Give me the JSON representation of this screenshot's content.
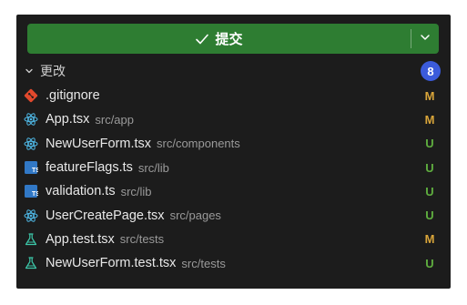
{
  "commit": {
    "label": "提交",
    "check_icon": "check-icon",
    "dropdown_icon": "chevron-down-icon",
    "color": "#2e7d32"
  },
  "changes": {
    "title": "更改",
    "count": "8",
    "badge_color": "#3b5bdb"
  },
  "files": [
    {
      "name": ".gitignore",
      "dir": "",
      "status": "M",
      "icon": "git-icon"
    },
    {
      "name": "App.tsx",
      "dir": "src/app",
      "status": "M",
      "icon": "react-icon"
    },
    {
      "name": "NewUserForm.tsx",
      "dir": "src/components",
      "status": "U",
      "icon": "react-icon"
    },
    {
      "name": "featureFlags.ts",
      "dir": "src/lib",
      "status": "U",
      "icon": "typescript-icon"
    },
    {
      "name": "validation.ts",
      "dir": "src/lib",
      "status": "U",
      "icon": "typescript-icon"
    },
    {
      "name": "UserCreatePage.tsx",
      "dir": "src/pages",
      "status": "U",
      "icon": "react-icon"
    },
    {
      "name": "App.test.tsx",
      "dir": "src/tests",
      "status": "M",
      "icon": "flask-icon"
    },
    {
      "name": "NewUserForm.test.tsx",
      "dir": "src/tests",
      "status": "U",
      "icon": "flask-icon"
    }
  ],
  "status_colors": {
    "M": "#d9a53a",
    "U": "#5fae3f"
  }
}
